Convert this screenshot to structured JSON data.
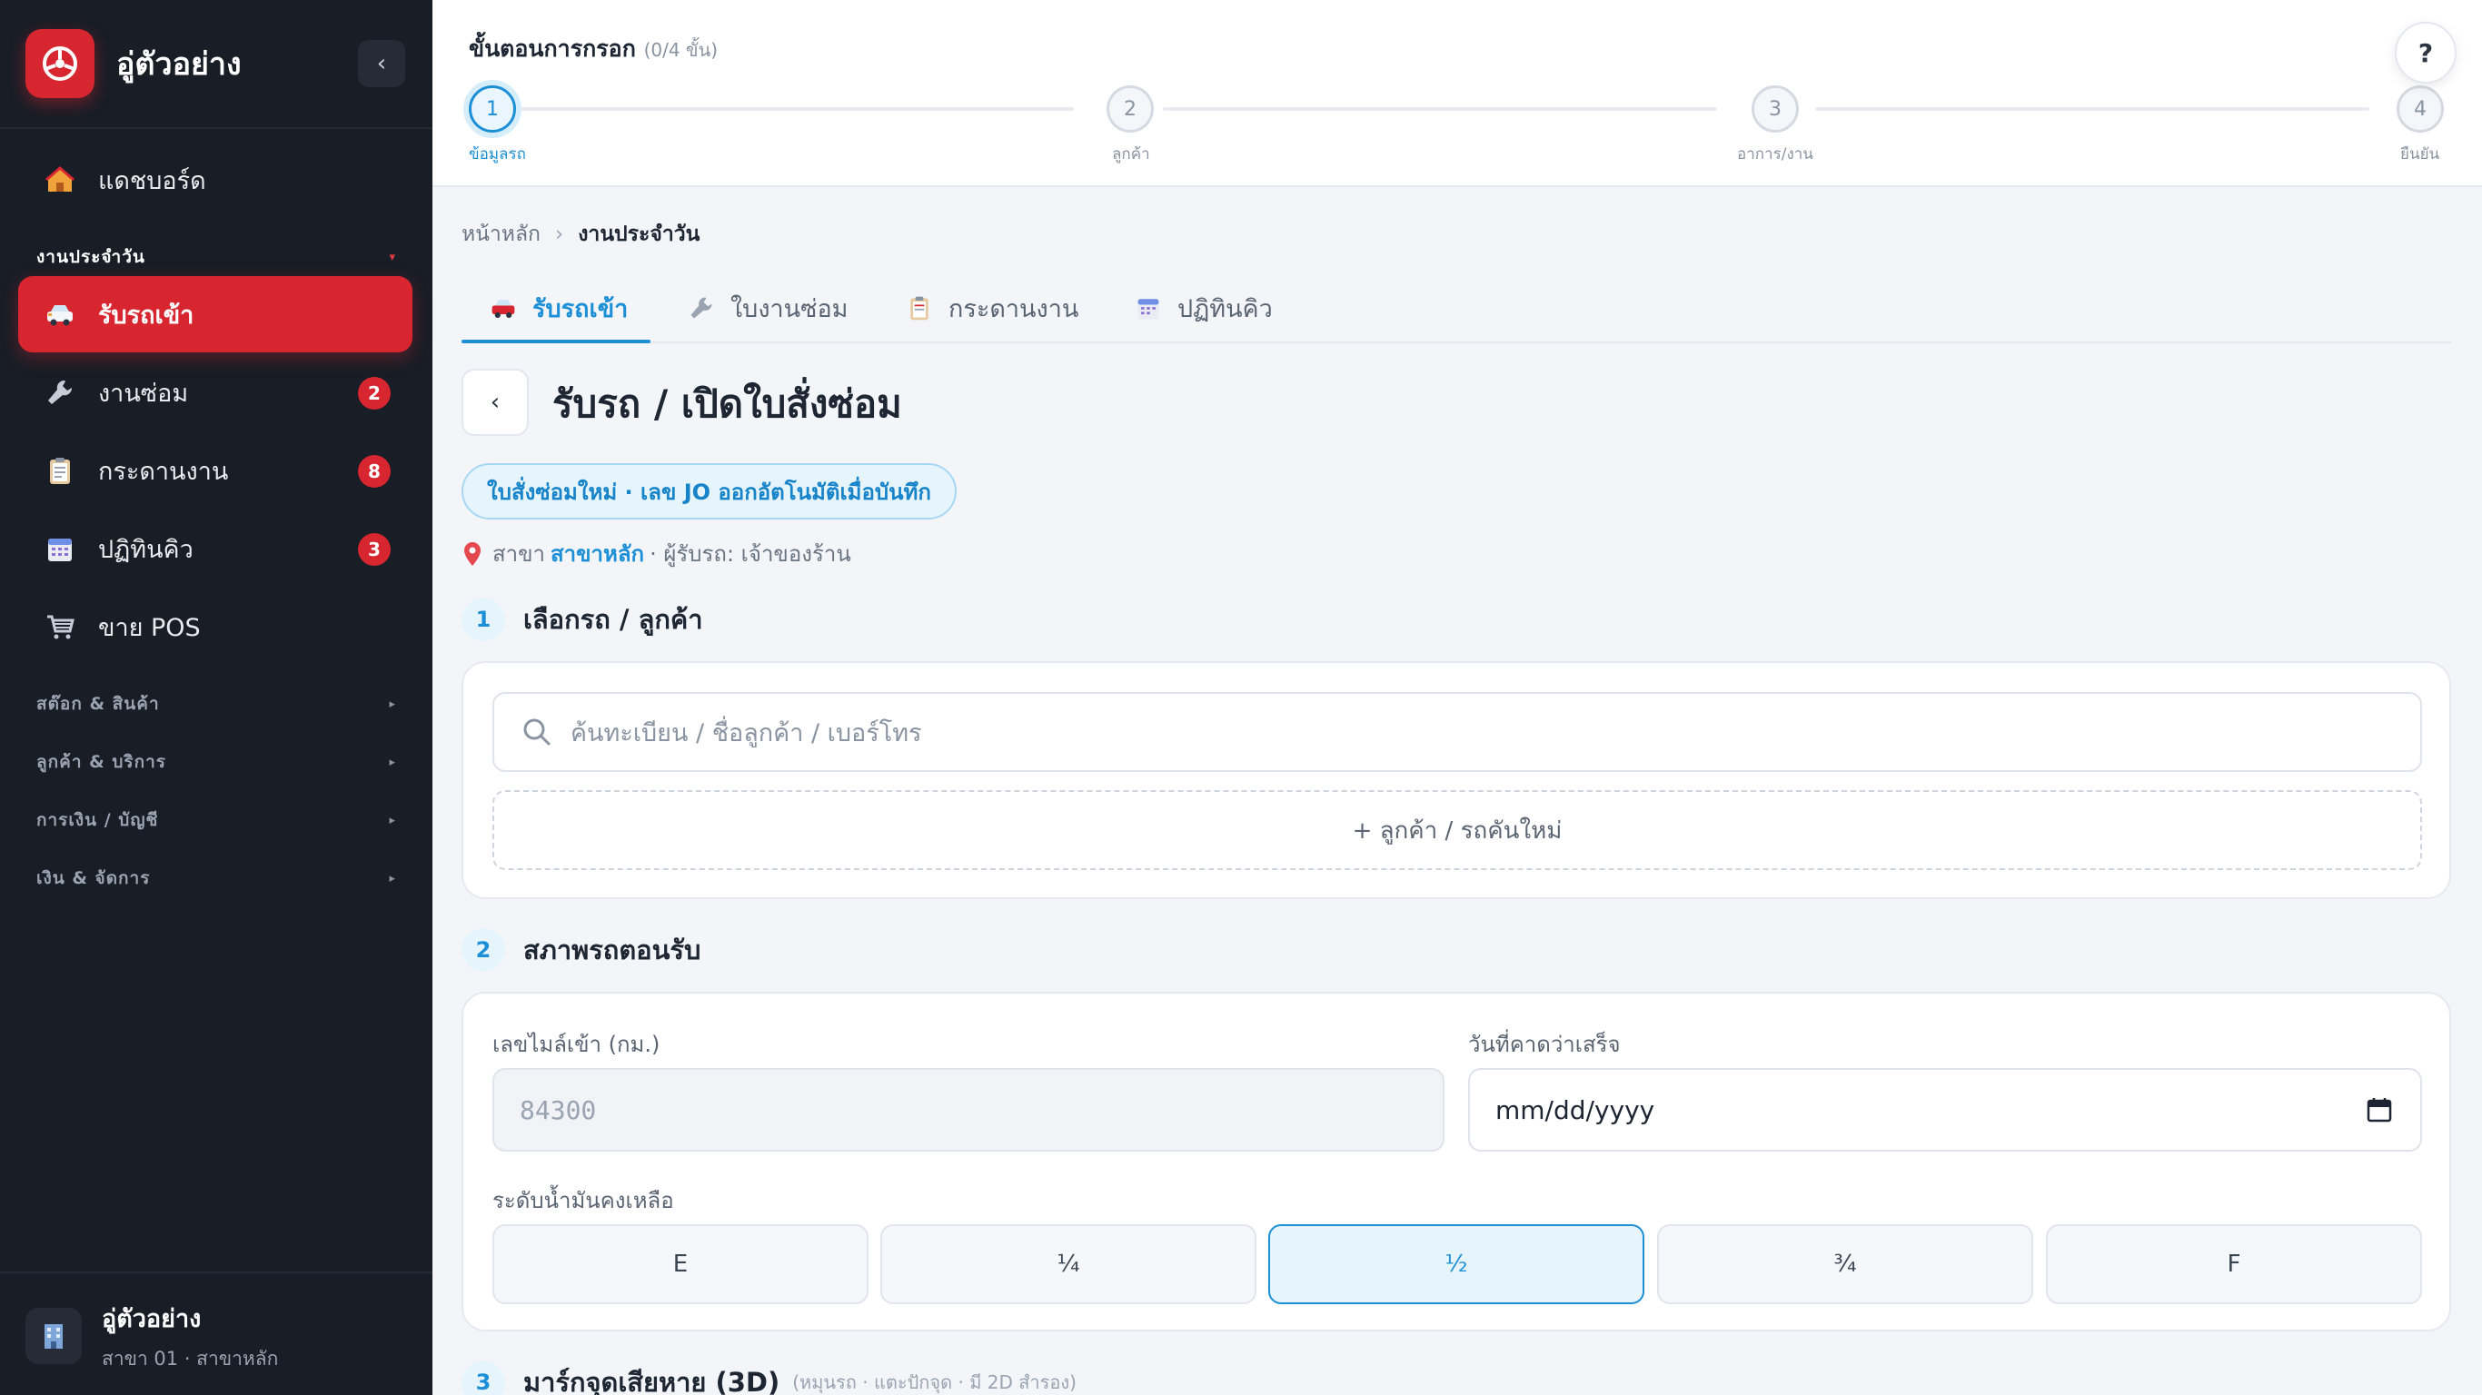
{
  "brand": {
    "name": "อู่ตัวอย่าง",
    "logo_icon": "steering-wheel-icon",
    "accent": "#d7262f",
    "collapse_glyph": "‹"
  },
  "sidebar": {
    "top_item": {
      "label": "แดชบอร์ด",
      "icon": "house-icon"
    },
    "section_open": {
      "label": "งานประจำวัน",
      "arrow": "▾"
    },
    "items": [
      {
        "label": "รับรถเข้า",
        "icon": "car-icon",
        "active": true,
        "badge": ""
      },
      {
        "label": "งานซ่อม",
        "icon": "wrench-icon",
        "active": false,
        "badge": "2"
      },
      {
        "label": "กระดานงาน",
        "icon": "clipboard-icon",
        "active": false,
        "badge": "8"
      },
      {
        "label": "ปฏิทินคิว",
        "icon": "calendar-icon",
        "active": false,
        "badge": "3"
      },
      {
        "label": "ขาย POS",
        "icon": "cart-icon",
        "active": false,
        "badge": ""
      }
    ],
    "sections": [
      {
        "label": "สต๊อก & สินค้า",
        "arrow": "▸"
      },
      {
        "label": "ลูกค้า & บริการ",
        "arrow": "▸"
      },
      {
        "label": "การเงิน / บัญชี",
        "arrow": "▸"
      },
      {
        "label": "เงิน & จัดการ",
        "arrow": "▸"
      }
    ],
    "footer": {
      "title": "อู่ตัวอย่าง",
      "subtitle": "สาขา 01 · สาขาหลัก",
      "icon": "building-icon"
    }
  },
  "stepper": {
    "title": "ขั้นตอนการกรอก",
    "progress": "(0/4 ขั้น)",
    "current_step": 1,
    "steps": [
      {
        "num": "1",
        "label": "ข้อมูลรถ"
      },
      {
        "num": "2",
        "label": "ลูกค้า"
      },
      {
        "num": "3",
        "label": "อาการ/งาน"
      },
      {
        "num": "4",
        "label": "ยืนยัน"
      }
    ],
    "help_label": "?"
  },
  "breadcrumb": {
    "home": "หน้าหลัก",
    "separator": "›",
    "current": "งานประจำวัน"
  },
  "tabs": [
    {
      "label": "รับรถเข้า",
      "icon": "car-icon",
      "active": true
    },
    {
      "label": "ใบงานซ่อม",
      "icon": "wrench-icon",
      "active": false
    },
    {
      "label": "กระดานงาน",
      "icon": "clipboard-icon",
      "active": false
    },
    {
      "label": "ปฏิทินคิว",
      "icon": "calendar-icon",
      "active": false
    }
  ],
  "page": {
    "back_glyph": "‹",
    "title": "รับรถ / เปิดใบสั่งซ่อม",
    "info_chip": "ใบสั่งซ่อมใหม่ · เลข JO ออกอัตโนมัติเมื่อบันทึก",
    "branch_prefix": "สาขา",
    "branch_name": "สาขาหลัก",
    "receiver": "· ผู้รับรถ: เจ้าของร้าน",
    "location_icon": "map-pin-icon"
  },
  "section1": {
    "num": "1",
    "title": "เลือกรถ / ลูกค้า",
    "search_placeholder": "ค้นทะเบียน / ชื่อลูกค้า / เบอร์โทร",
    "add_new_label": "+ ลูกค้า / รถคันใหม่"
  },
  "section2": {
    "num": "2",
    "title": "สภาพรถตอนรับ",
    "mileage_label": "เลขไมล์เข้า (กม.)",
    "mileage_value": "84300",
    "due_label": "วันที่คาดว่าเสร็จ",
    "due_placeholder": "mm/dd/yyyy",
    "fuel_label": "ระดับน้ำมันคงเหลือ",
    "fuel_levels": [
      "E",
      "¼",
      "½",
      "¾",
      "F"
    ],
    "fuel_selected": "½"
  },
  "section3": {
    "num": "3",
    "title": "มาร์กจุดเสียหาย (3D)",
    "note": "(หมุนรถ · แตะปักจุด · มี 2D สำรอง)"
  },
  "colors": {
    "primary": "#1d8fd6",
    "danger": "#d7262f",
    "sidebar_bg": "#181d26"
  }
}
